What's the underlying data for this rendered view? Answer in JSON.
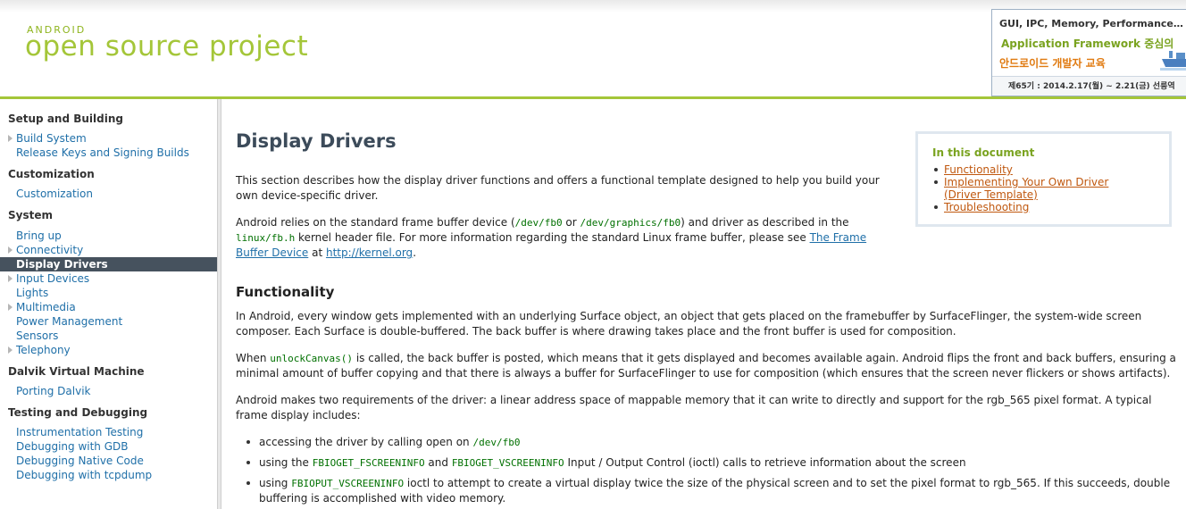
{
  "header": {
    "logo_small": "ANDROID",
    "logo_big": "open source project"
  },
  "ad": {
    "line1": "GUI, IPC, Memory, Performance…",
    "line2": "Application Framework 중심의",
    "line3": "안드로이드 개발자 교육",
    "line4": "제65기 : 2014.2.17(월) ~ 2.21(금) 선릉역"
  },
  "sidebar": {
    "sections": [
      {
        "title": "Setup and Building",
        "items": [
          {
            "label": "Build System",
            "arrow": true
          },
          {
            "label": "Release Keys and Signing Builds",
            "arrow": false
          }
        ]
      },
      {
        "title": "Customization",
        "items": [
          {
            "label": "Customization",
            "arrow": false
          }
        ]
      },
      {
        "title": "System",
        "items": [
          {
            "label": "Bring up",
            "arrow": false
          },
          {
            "label": "Connectivity",
            "arrow": true
          },
          {
            "label": "Display Drivers",
            "arrow": false,
            "active": true
          },
          {
            "label": "Input Devices",
            "arrow": true
          },
          {
            "label": "Lights",
            "arrow": false
          },
          {
            "label": "Multimedia",
            "arrow": true
          },
          {
            "label": "Power Management",
            "arrow": false
          },
          {
            "label": "Sensors",
            "arrow": false
          },
          {
            "label": "Telephony",
            "arrow": true
          }
        ]
      },
      {
        "title": "Dalvik Virtual Machine",
        "items": [
          {
            "label": "Porting Dalvik",
            "arrow": false
          }
        ]
      },
      {
        "title": "Testing and Debugging",
        "items": [
          {
            "label": "Instrumentation Testing",
            "arrow": false
          },
          {
            "label": "Debugging with GDB",
            "arrow": false
          },
          {
            "label": "Debugging Native Code",
            "arrow": false
          },
          {
            "label": "Debugging with tcpdump",
            "arrow": false
          }
        ]
      }
    ]
  },
  "main": {
    "title": "Display Drivers",
    "intro": "This section describes how the display driver functions and offers a functional template designed to help you build your own device-specific driver.",
    "p2": {
      "t1": "Android relies on the standard frame buffer device (",
      "c1": "/dev/fb0",
      "t2": " or ",
      "c2": "/dev/graphics/fb0",
      "t3": ") and driver as described in the",
      "c3": "linux/fb.h",
      "t4": " kernel header file. For more information regarding the standard Linux frame buffer, please see ",
      "link1": "The Frame Buffer Device",
      "t5": " at ",
      "link2": "http://kernel.org",
      "t6": "."
    },
    "section_title": "Functionality",
    "p3": "In Android, every window gets implemented with an underlying Surface object, an object that gets placed on the framebuffer by SurfaceFlinger, the system-wide screen composer. Each Surface is double-buffered. The back buffer is where drawing takes place and the front buffer is used for composition.",
    "p4": {
      "t1": "When ",
      "c1": "unlockCanvas()",
      "t2": " is called, the back buffer is posted, which means that it gets displayed and  becomes available again. Android flips the front and back buffers, ensuring a minimal amount of buffer copying and that there is always a buffer for SurfaceFlinger to use for composition (which ensures that the screen never flickers or shows artifacts)."
    },
    "p5": "Android makes two requirements of the driver: a linear address space of mappable memory that it can write to directly and support for the rgb_565 pixel format. A typical frame display includes:",
    "bullets": [
      {
        "t1": "accessing the driver by calling open on ",
        "c1": "/dev/fb0",
        "t2": ""
      },
      {
        "t1": "using the ",
        "c1": "FBIOGET_FSCREENINFO",
        "t2": " and ",
        "c2": "FBIOGET_VSCREENINFO",
        "t3": " Input / Output Control (ioctl) calls to retrieve information about the screen"
      },
      {
        "t1": "using ",
        "c1": "FBIOPUT_VSCREENINFO",
        "t2": " ioctl to attempt to create a virtual display twice the size of the physical screen and to set the pixel format to rgb_565. If this succeeds, double buffering is accomplished with video memory."
      }
    ]
  },
  "toc": {
    "title": "In this document",
    "items": [
      "Functionality",
      "Implementing Your Own Driver (Driver Template)",
      "Troubleshooting"
    ]
  },
  "colors": {
    "brand_green": "#a4c639",
    "link_blue": "#1f6fa8",
    "toc_link_orange": "#c0580f",
    "code_green": "#007000",
    "active_nav_bg": "#46525e"
  }
}
